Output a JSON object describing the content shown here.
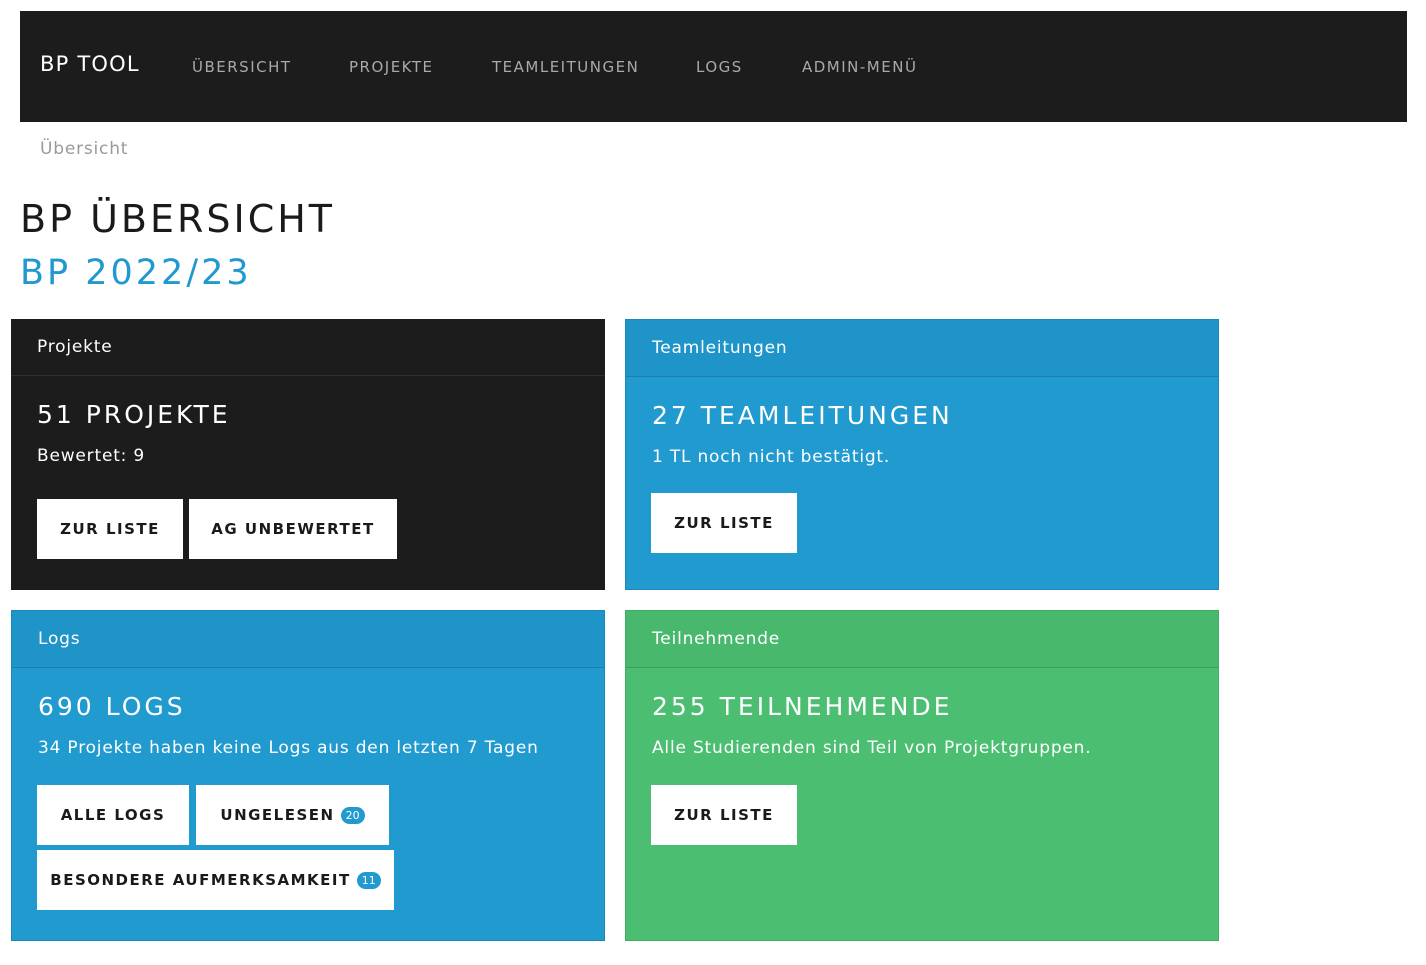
{
  "nav": {
    "brand": "BP TOOL",
    "items": [
      "ÜBERSICHT",
      "PROJEKTE",
      "TEAMLEITUNGEN",
      "LOGS",
      "ADMIN-MENÜ"
    ]
  },
  "breadcrumb": "Übersicht",
  "page": {
    "title": "BP ÜBERSICHT",
    "subtitle": "BP 2022/23"
  },
  "cards": {
    "projects": {
      "header": "Projekte",
      "count": "51 PROJEKTE",
      "text": "Bewertet: 9",
      "buttons": {
        "list": "ZUR LISTE",
        "unrated": "AG UNBEWERTET"
      }
    },
    "teamleads": {
      "header": "Teamleitungen",
      "count": "27 TEAMLEITUNGEN",
      "text": "1 TL noch nicht bestätigt.",
      "buttons": {
        "list": "ZUR LISTE"
      }
    },
    "logs": {
      "header": "Logs",
      "count": "690 LOGS",
      "text": "34 Projekte haben keine Logs aus den letzten 7 Tagen",
      "buttons": {
        "all": "ALLE LOGS",
        "unread": "UNGELESEN",
        "unread_badge": "20",
        "attention": "BESONDERE AUFMERKSAMKEIT",
        "attention_badge": "11"
      }
    },
    "participants": {
      "header": "Teilnehmende",
      "count": "255 TEILNEHMENDE",
      "text": "Alle Studierenden sind Teil von Projektgruppen.",
      "buttons": {
        "list": "ZUR LISTE"
      }
    }
  },
  "colors": {
    "navbar": "#1c1c1c",
    "accent_blue": "#219acf",
    "accent_green": "#4cbe72"
  }
}
